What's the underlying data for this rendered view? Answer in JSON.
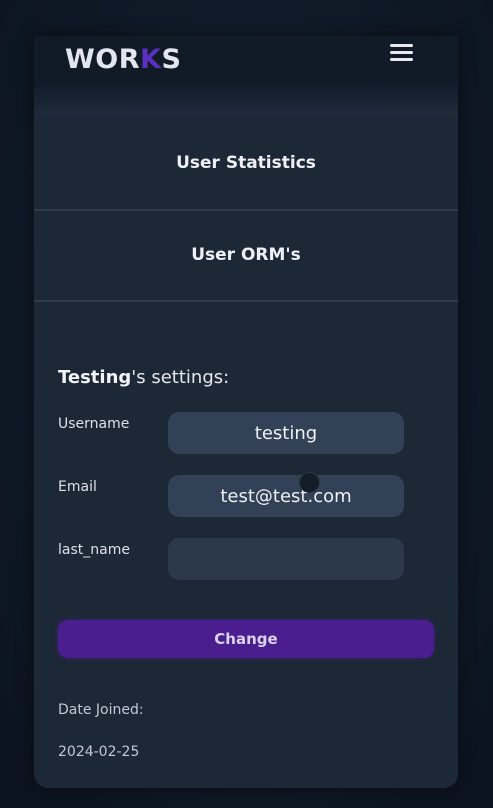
{
  "header": {
    "logo_prefix": "WOR",
    "logo_accent": "K",
    "logo_suffix": "S",
    "menu_icon": "hamburger-menu-icon"
  },
  "nav": {
    "items": [
      {
        "label": "User Statistics"
      },
      {
        "label": "User ORM's"
      }
    ]
  },
  "settings": {
    "title_user": "Testing",
    "title_suffix": "'s settings:",
    "fields": [
      {
        "label": "Username",
        "value": "testing"
      },
      {
        "label": "Email",
        "value": "test@test.com"
      },
      {
        "label": "last_name",
        "value": ""
      }
    ],
    "submit_label": "Change",
    "date_joined_label": "Date Joined:",
    "date_joined_value": "2024-02-25"
  },
  "colors": {
    "accent": "#4b1e8f",
    "logo_accent": "#5b2fbf",
    "card_bg": "#1d2837",
    "field_bg": "#324155"
  }
}
